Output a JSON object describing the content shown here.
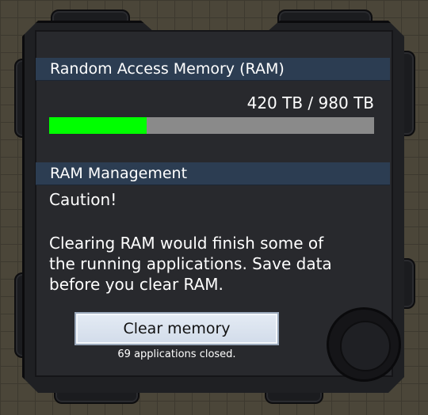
{
  "ram_section": {
    "title": "Random Access Memory (RAM)",
    "usage_text": "420 TB / 980 TB",
    "used_fraction": 0.3,
    "bar_fill_color": "#00ff00",
    "bar_track_color": "#8a8a8a"
  },
  "management_section": {
    "title": "RAM Management",
    "caution": "Caution!",
    "description": "Clearing RAM would finish some of the running applications. Save data before you clear RAM.",
    "clear_button_label": "Clear memory",
    "status_text": "69 applications closed."
  },
  "colors": {
    "section_bar": "#2c3d52",
    "panel_bg": "#28292d"
  }
}
